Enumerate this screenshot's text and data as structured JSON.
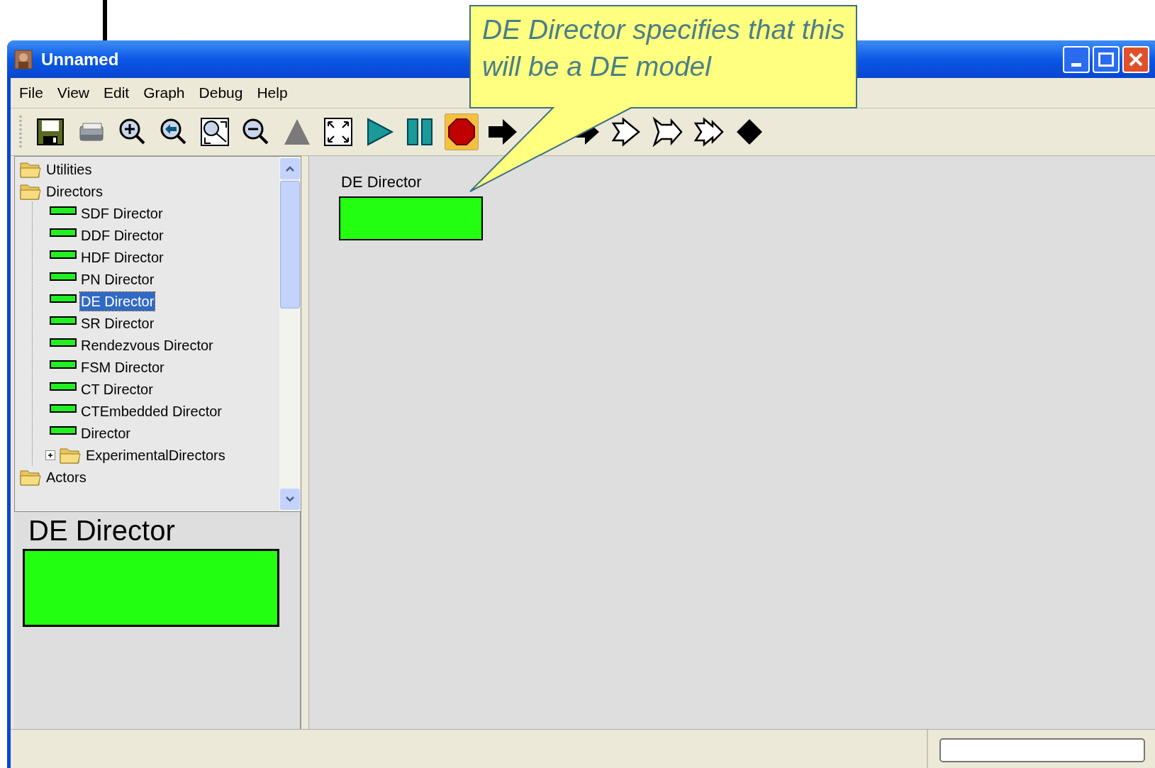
{
  "window": {
    "title": "Unnamed"
  },
  "menu": [
    "File",
    "View",
    "Edit",
    "Graph",
    "Debug",
    "Help"
  ],
  "toolbar": [
    {
      "kind": "save",
      "selected": false
    },
    {
      "kind": "print",
      "selected": false
    },
    {
      "kind": "zoom-in",
      "selected": false
    },
    {
      "kind": "zoom-reset",
      "selected": false
    },
    {
      "kind": "zoom-fit",
      "selected": false
    },
    {
      "kind": "zoom-out",
      "selected": false
    },
    {
      "kind": "triangle",
      "selected": false
    },
    {
      "kind": "fullscreen",
      "selected": false
    },
    {
      "kind": "play",
      "selected": false
    },
    {
      "kind": "pause",
      "selected": false
    },
    {
      "kind": "stop",
      "selected": true
    },
    {
      "kind": "arrow",
      "selected": false
    },
    {
      "kind": "arrow-partial",
      "selected": false
    },
    {
      "kind": "outline-arrow",
      "selected": false
    },
    {
      "kind": "outline-flag",
      "selected": false
    },
    {
      "kind": "outline-double",
      "selected": false
    },
    {
      "kind": "diamond",
      "selected": false
    }
  ],
  "tree": [
    {
      "label": "Utilities",
      "kind": "folder"
    },
    {
      "label": "Directors",
      "kind": "folder",
      "children": [
        {
          "label": "SDF Director",
          "kind": "director",
          "selected": false
        },
        {
          "label": "DDF Director",
          "kind": "director",
          "selected": false
        },
        {
          "label": "HDF Director",
          "kind": "director",
          "selected": false
        },
        {
          "label": "PN Director",
          "kind": "director",
          "selected": false
        },
        {
          "label": "DE Director",
          "kind": "director",
          "selected": true
        },
        {
          "label": "SR Director",
          "kind": "director",
          "selected": false
        },
        {
          "label": "Rendezvous Director",
          "kind": "director",
          "selected": false
        },
        {
          "label": "FSM Director",
          "kind": "director",
          "selected": false
        },
        {
          "label": "CT Director",
          "kind": "director",
          "selected": false
        },
        {
          "label": "CTEmbedded Director",
          "kind": "director",
          "selected": false
        },
        {
          "label": "Director",
          "kind": "director",
          "selected": false
        },
        {
          "label": "ExperimentalDirectors",
          "kind": "folder",
          "expanded": false
        }
      ]
    },
    {
      "label": "Actors",
      "kind": "folder"
    }
  ],
  "preview": {
    "label": "DE Director"
  },
  "canvas": {
    "entities": [
      {
        "label": "DE Director"
      }
    ]
  },
  "callout": {
    "text": "DE Director specifies that this will be a DE model"
  }
}
